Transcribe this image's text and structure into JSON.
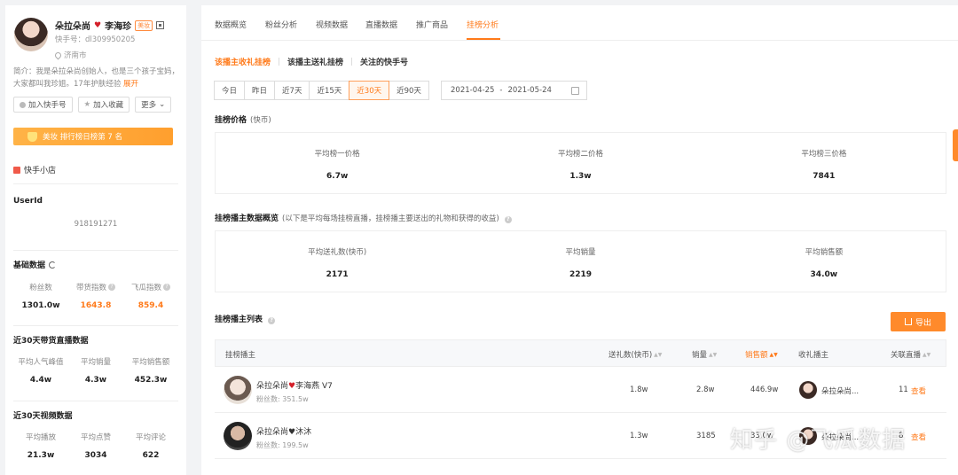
{
  "profile": {
    "name": "朵拉朵尚",
    "name_suffix": "李海珍",
    "verified_tag": "美妆",
    "kuaishou_id": "快手号：dl309950205",
    "city": "济南市",
    "intro": "简介：我是朵拉朵尚创始人，也是三个孩子宝妈，大家都叫我珍姐。17年护肤经验",
    "intro_more": "展开",
    "add_button": "加入快手号",
    "favorite_button": "加入收藏",
    "more_button": "更多",
    "rank_text": "美妆 排行榜日榜第 7 名",
    "shop_label": "快手小店",
    "userid_label": "UserId",
    "userid_value": "918191271"
  },
  "basic": {
    "title": "基础数据",
    "stats": [
      {
        "label": "粉丝数",
        "value": "1301.0w"
      },
      {
        "label": "带货指数",
        "value": "1643.8"
      },
      {
        "label": "飞瓜指数",
        "value": "859.4"
      }
    ]
  },
  "live30": {
    "title": "近30天带货直播数据",
    "stats": [
      {
        "label": "平均人气峰值",
        "value": "4.4w"
      },
      {
        "label": "平均销量",
        "value": "4.3w"
      },
      {
        "label": "平均销售额",
        "value": "452.3w"
      }
    ]
  },
  "video30": {
    "title": "近30天视频数据",
    "stats": [
      {
        "label": "平均播放",
        "value": "21.3w"
      },
      {
        "label": "平均点赞",
        "value": "3034"
      },
      {
        "label": "平均评论",
        "value": "622"
      }
    ]
  },
  "tabs": [
    "数据概览",
    "粉丝分析",
    "视频数据",
    "直播数据",
    "推广商品",
    "挂榜分析"
  ],
  "subtabs": [
    "该播主收礼挂榜",
    "该播主送礼挂榜",
    "关注的快手号"
  ],
  "date_buttons": [
    "今日",
    "昨日",
    "近7天",
    "近15天",
    "近30天",
    "近90天"
  ],
  "date_range": {
    "start": "2021-04-25",
    "sep": "-",
    "end": "2021-05-24"
  },
  "price_section": {
    "title": "挂榜价格",
    "unit": "(快币)",
    "items": [
      {
        "label": "平均榜一价格",
        "value": "6.7w"
      },
      {
        "label": "平均榜二价格",
        "value": "1.3w"
      },
      {
        "label": "平均榜三价格",
        "value": "7841"
      }
    ]
  },
  "overview_section": {
    "title": "挂榜播主数据概览",
    "note": "(以下是平均每场挂榜直播，挂榜播主要送出的礼物和获得的收益)",
    "items": [
      {
        "label": "平均送礼数(快币)",
        "value": "2171"
      },
      {
        "label": "平均销量",
        "value": "2219"
      },
      {
        "label": "平均销售额",
        "value": "34.0w"
      }
    ]
  },
  "list_section": {
    "title": "挂榜播主列表",
    "export_label": "导出",
    "headers": [
      "挂榜播主",
      "送礼数(快币)",
      "销量",
      "销售额",
      "收礼播主",
      "关联直播"
    ],
    "rows": [
      {
        "name": "朵拉朵尚",
        "name_suffix": "李海燕 V7",
        "fans": "粉丝数: 351.5w",
        "gifts": "1.8w",
        "sales": "2.8w",
        "revenue": "446.9w",
        "receiver": "朵拉朵尚...",
        "live_count": "11",
        "live_link": "查看"
      },
      {
        "name": "朵拉朵尚♥沐沐",
        "name_suffix": "",
        "fans": "粉丝数: 199.5w",
        "gifts": "1.3w",
        "sales": "3185",
        "revenue": "33.0w",
        "receiver": "朵拉朵尚...",
        "live_count": "8",
        "live_link": "查看"
      }
    ]
  },
  "watermark": "知乎 @飞瓜数据"
}
